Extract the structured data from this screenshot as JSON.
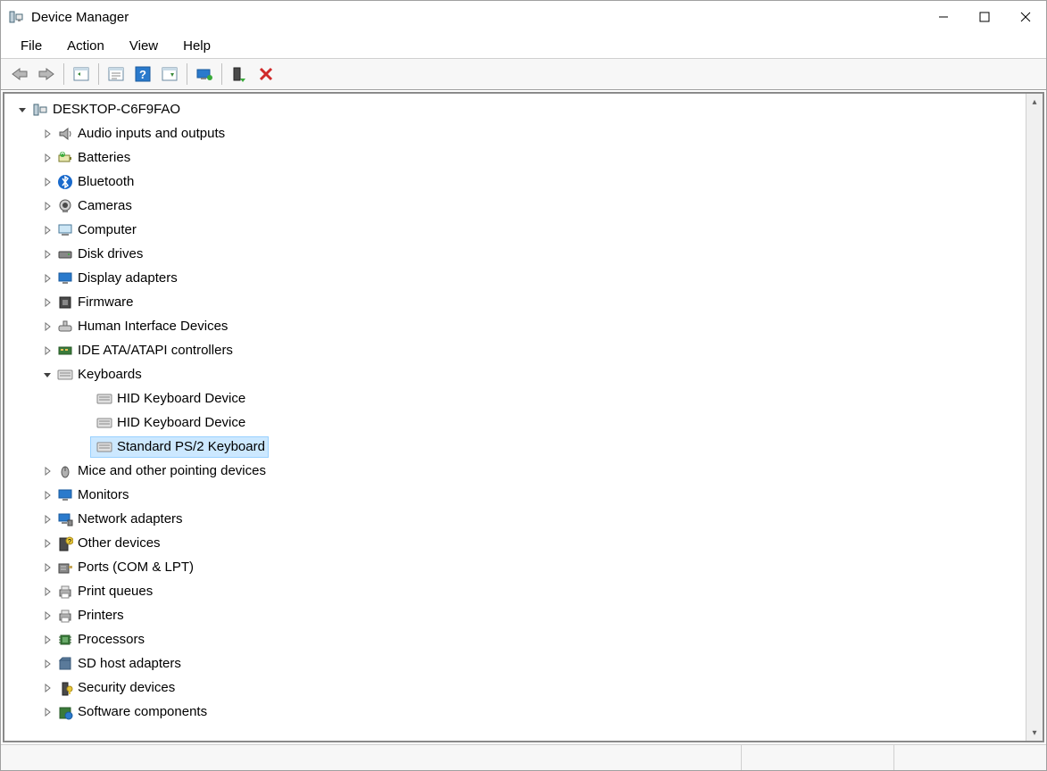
{
  "window": {
    "title": "Device Manager"
  },
  "menu": {
    "file": "File",
    "action": "Action",
    "view": "View",
    "help": "Help"
  },
  "toolbar_icons": {
    "back": "back-icon",
    "forward": "forward-icon",
    "show_tree": "show-tree-icon",
    "properties": "properties-icon",
    "help": "help-icon",
    "scan": "scan-hardware-icon",
    "monitor": "monitor-icon",
    "enable": "enable-device-icon",
    "disable": "disable-device-icon"
  },
  "tree": {
    "root": "DESKTOP-C6F9FAO",
    "nodes": [
      {
        "label": "Audio inputs and outputs",
        "icon": "audio"
      },
      {
        "label": "Batteries",
        "icon": "battery"
      },
      {
        "label": "Bluetooth",
        "icon": "bluetooth"
      },
      {
        "label": "Cameras",
        "icon": "camera"
      },
      {
        "label": "Computer",
        "icon": "computer"
      },
      {
        "label": "Disk drives",
        "icon": "disk"
      },
      {
        "label": "Display adapters",
        "icon": "display"
      },
      {
        "label": "Firmware",
        "icon": "firmware"
      },
      {
        "label": "Human Interface Devices",
        "icon": "hid"
      },
      {
        "label": "IDE ATA/ATAPI controllers",
        "icon": "ide"
      },
      {
        "label": "Keyboards",
        "icon": "keyboard",
        "expanded": true,
        "children": [
          {
            "label": "HID Keyboard Device",
            "icon": "keyboard"
          },
          {
            "label": "HID Keyboard Device",
            "icon": "keyboard"
          },
          {
            "label": "Standard PS/2 Keyboard",
            "icon": "keyboard",
            "selected": true
          }
        ]
      },
      {
        "label": "Mice and other pointing devices",
        "icon": "mouse"
      },
      {
        "label": "Monitors",
        "icon": "monitor"
      },
      {
        "label": "Network adapters",
        "icon": "network"
      },
      {
        "label": "Other devices",
        "icon": "other"
      },
      {
        "label": "Ports (COM & LPT)",
        "icon": "port"
      },
      {
        "label": "Print queues",
        "icon": "printer"
      },
      {
        "label": "Printers",
        "icon": "printer"
      },
      {
        "label": "Processors",
        "icon": "processor"
      },
      {
        "label": "SD host adapters",
        "icon": "sd"
      },
      {
        "label": "Security devices",
        "icon": "security"
      },
      {
        "label": "Software components",
        "icon": "software",
        "partial": true
      }
    ]
  }
}
